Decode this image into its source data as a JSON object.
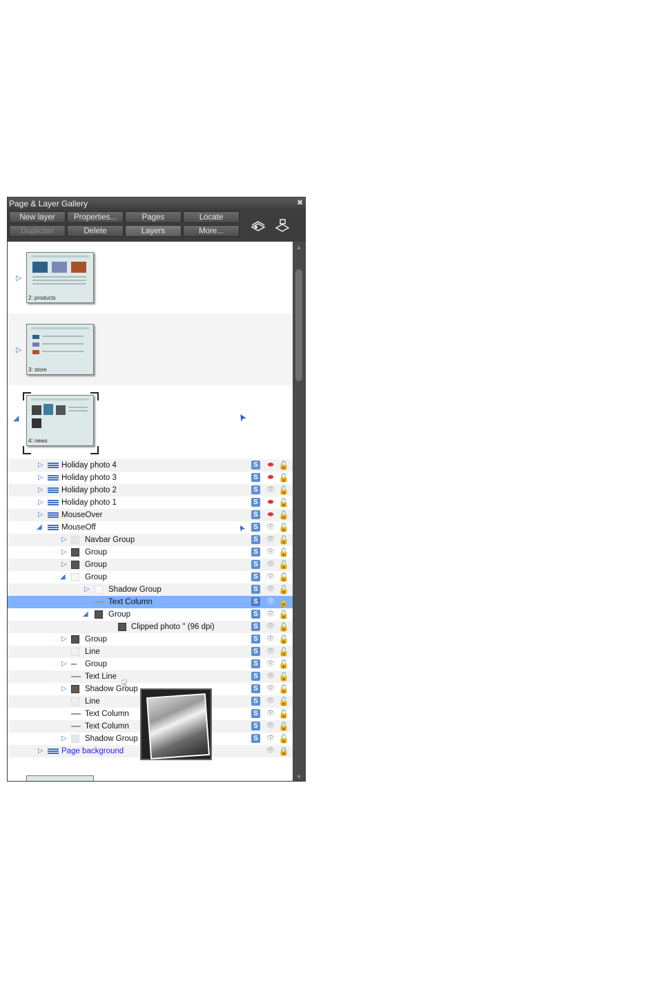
{
  "window": {
    "title": "Page & Layer Gallery",
    "close_glyph": "✖"
  },
  "toolbar": {
    "buttons_row1": [
      "New layer",
      "Properties...",
      "Pages",
      "Locate"
    ],
    "buttons_row2": [
      "Duplicate",
      "Delete",
      "Layers",
      "More..."
    ]
  },
  "pages": [
    {
      "caption": "2: products"
    },
    {
      "caption": "3: store"
    },
    {
      "caption": "4: news"
    }
  ],
  "layers": [
    {
      "label": "Holiday photo 4",
      "visible": false
    },
    {
      "label": "Holiday photo 3",
      "visible": false
    },
    {
      "label": "Holiday photo 2",
      "visible": true
    },
    {
      "label": "Holiday photo 1",
      "visible": false
    },
    {
      "label": "MouseOver",
      "visible": false
    },
    {
      "label": "MouseOff",
      "visible": true
    }
  ],
  "objects": [
    {
      "label": "Navbar Group"
    },
    {
      "label": "Group"
    },
    {
      "label": "Group"
    },
    {
      "label": "Group"
    },
    {
      "label": "Shadow Group"
    },
    {
      "label": "Text Column"
    },
    {
      "label": "Group"
    },
    {
      "label": "Clipped photo '' (96 dpi)"
    },
    {
      "label": "Group"
    },
    {
      "label": "Line"
    },
    {
      "label": "Group"
    },
    {
      "label": "Text Line"
    },
    {
      "label": "Shadow Group"
    },
    {
      "label": "Line"
    },
    {
      "label": "Text Column"
    },
    {
      "label": "Text Column"
    },
    {
      "label": "Shadow Group"
    }
  ],
  "background_layer": {
    "label": "Page background"
  },
  "icons": {
    "state": "S",
    "eye": "👁",
    "eye_closed": "⬬",
    "lock": "🔓",
    "lock_closed": "🔒",
    "expand": "▷",
    "collapse": "◢",
    "cursor": "➤",
    "hand": "☟"
  },
  "colors": {
    "selection": "#7fb2ff",
    "link_blue": "#2020ff",
    "hidden_red": "#e0302f"
  }
}
